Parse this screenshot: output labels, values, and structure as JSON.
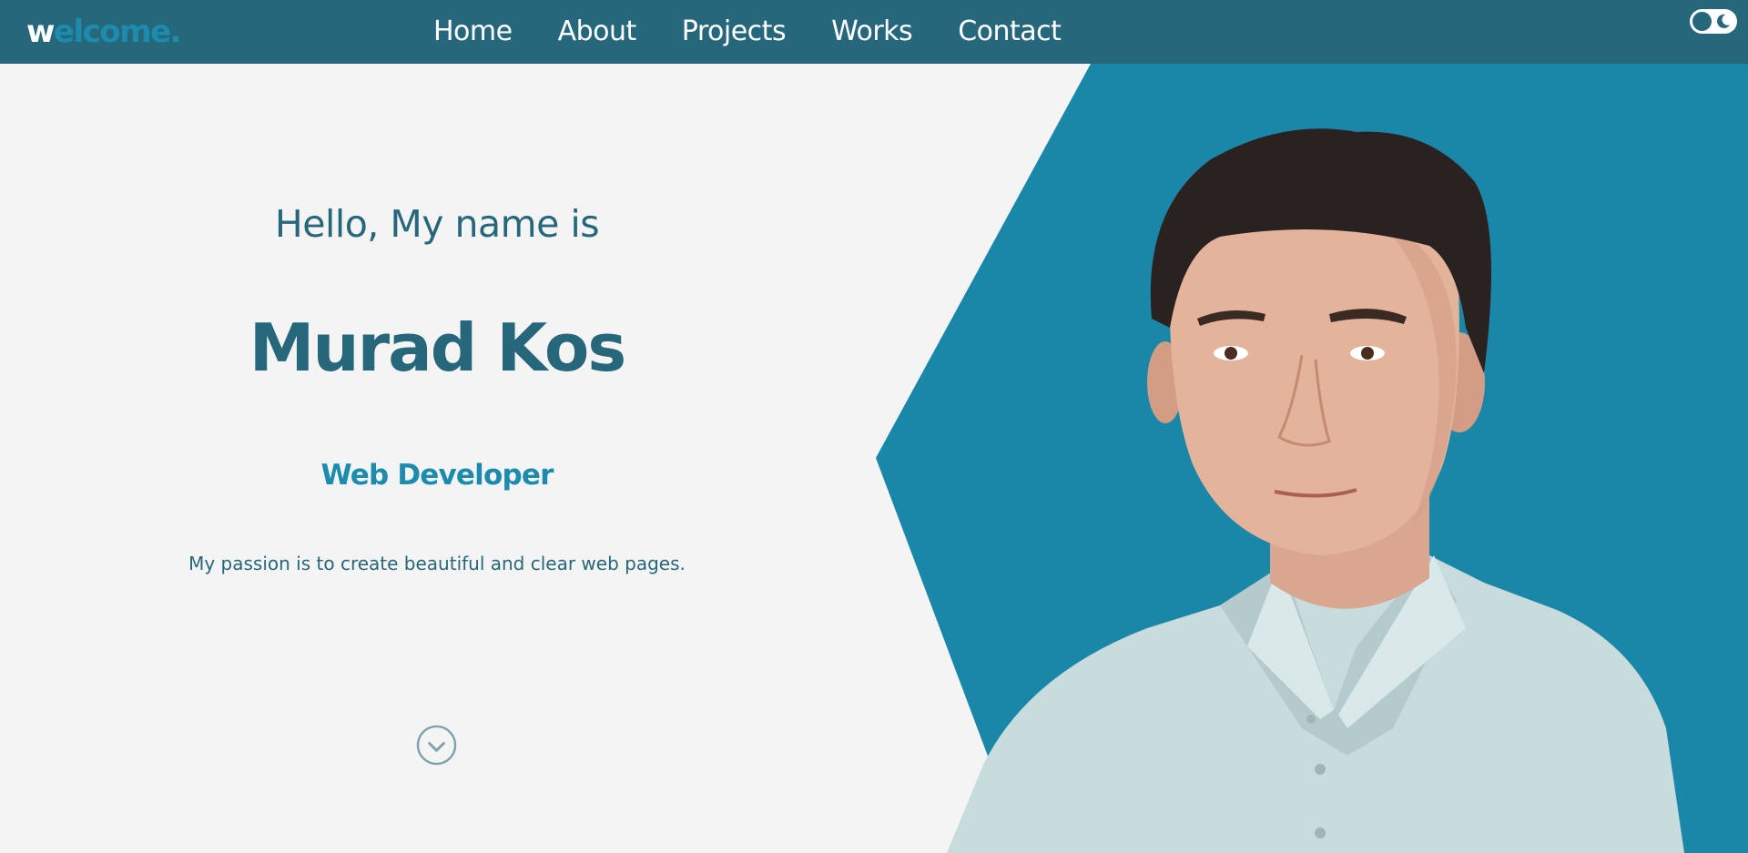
{
  "navbar": {
    "logo_first": "w",
    "logo_rest": "elcome.",
    "links": [
      {
        "label": "Home"
      },
      {
        "label": "About"
      },
      {
        "label": "Projects"
      },
      {
        "label": "Works"
      },
      {
        "label": "Contact"
      }
    ],
    "theme_toggle_icon": "moon-icon"
  },
  "hero": {
    "greeting": "Hello, My name is",
    "name": "Murad Kos",
    "role": "Web Developer",
    "tagline": "My passion is to create beautiful and clear web pages.",
    "scroll_icon": "chevron-down-icon"
  },
  "colors": {
    "navbar_bg": "#27677b",
    "accent": "#1c8bad",
    "text_primary": "#27677b",
    "page_bg": "#f4f4f4"
  }
}
